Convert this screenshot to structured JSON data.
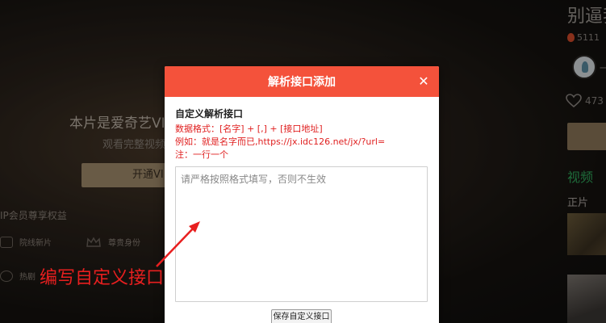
{
  "background": {
    "title": "本片是爱奇艺VI",
    "subtitle": "观看完整视频",
    "vip_button": "开通VI",
    "rights_heading": "IP会员尊享权益",
    "perks": [
      "院线新片",
      "尊贵身份",
      "热剧"
    ]
  },
  "right_column": {
    "title": "别逼我",
    "hot_count": "5111",
    "author_suffix": "一",
    "like_count": "473",
    "video_heading": "视频",
    "episode_label": "正片"
  },
  "dialog": {
    "title": "解析接口添加",
    "close_icon": "close-icon",
    "section_title": "自定义解析接口",
    "format_hint": "数据格式：[名字] + [,] + [接口地址]",
    "example_hint": "例如：就是名字而已,https://jx.idc126.net/jx/?url=",
    "note_hint": "注：一行一个",
    "input": {
      "value": "",
      "placeholder": "请严格按照格式填写，否则不生效"
    },
    "save_button": "保存自定义接口"
  },
  "annotation": {
    "text": "编写自定义接口"
  },
  "colors": {
    "header": "#f4523b",
    "hint_red": "#e02020",
    "annotation_red": "#e81f1f"
  }
}
